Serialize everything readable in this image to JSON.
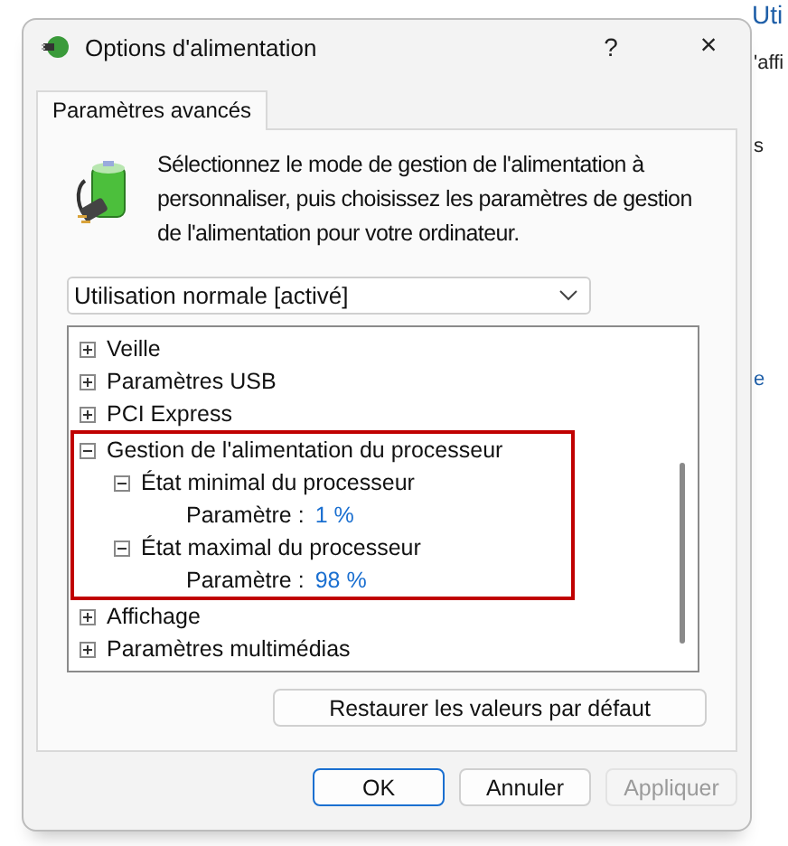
{
  "background": {
    "heading": "Uti",
    "texts": [
      "'affi",
      "s",
      "e"
    ]
  },
  "window": {
    "title": "Options d'alimentation",
    "help": "?",
    "close": "×"
  },
  "tabs": [
    {
      "label": "Paramètres avancés",
      "selected": true
    }
  ],
  "description": "Sélectionnez le mode de gestion de l'alimentation à personnaliser, puis choisissez les paramètres de gestion de l'alimentation pour votre ordinateur.",
  "plan_select": {
    "value": "Utilisation normale [activé]"
  },
  "tree": [
    {
      "label": "Veille",
      "expanded": false,
      "highlighted": false
    },
    {
      "label": "Paramètres USB",
      "expanded": false,
      "highlighted": false
    },
    {
      "label": "PCI Express",
      "expanded": false,
      "highlighted": false
    },
    {
      "label": "Gestion de l'alimentation du processeur",
      "expanded": true,
      "highlighted": true,
      "children": [
        {
          "label": "État minimal du processeur",
          "expanded": true,
          "highlighted": false,
          "setting": {
            "label": "Paramètre :",
            "value": "1 %"
          }
        },
        {
          "label": "État maximal du processeur",
          "expanded": true,
          "highlighted": false,
          "setting": {
            "label": "Paramètre :",
            "value": "98 %"
          }
        }
      ]
    },
    {
      "label": "Affichage",
      "expanded": false,
      "highlighted": false
    },
    {
      "label": "Paramètres multimédias",
      "expanded": false,
      "highlighted": false
    }
  ],
  "restore_button": "Restaurer les valeurs par défaut",
  "buttons": [
    {
      "label": "OK",
      "kind": "default",
      "disabled": false
    },
    {
      "label": "Annuler",
      "kind": "normal",
      "disabled": false
    },
    {
      "label": "Appliquer",
      "kind": "normal",
      "disabled": true
    }
  ]
}
